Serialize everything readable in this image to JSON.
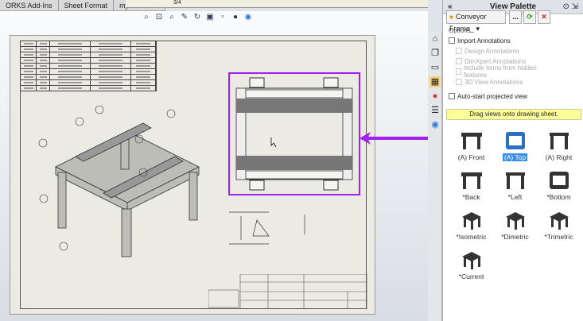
{
  "tabs": [
    "ORKS Add-Ins",
    "Sheet Format",
    "myCADtools"
  ],
  "ruler_label": "3/4",
  "toolbar_icons": [
    "zoom-to-fit-icon",
    "zoom-area-icon",
    "zoom-in-out-icon",
    "pan-icon",
    "rotate-icon",
    "display-style-icon",
    "hide-show-icon",
    "appearance-icon",
    "scene-icon"
  ],
  "panel": {
    "title": "View Palette",
    "collapse": "«",
    "pin": "⊙ ⇲",
    "part": "Conveyor Frame_",
    "browse": "...",
    "options_label": "Options",
    "options": [
      {
        "label": "Import Annotations",
        "enabled": true,
        "checked": false
      },
      {
        "label": "Design Annotations",
        "enabled": false,
        "checked": false
      },
      {
        "label": "DimXpert Annotations",
        "enabled": false,
        "checked": false
      },
      {
        "label": "Include items from hidden features",
        "enabled": false,
        "checked": false
      },
      {
        "label": "3D View Annotations",
        "enabled": false,
        "checked": false
      }
    ],
    "auto_start": "Auto-start projected view",
    "hint": "Drag views onto drawing sheet.",
    "views": [
      {
        "label": "(A) Front",
        "shape": "front"
      },
      {
        "label": "(A) Top",
        "shape": "top",
        "selected": true
      },
      {
        "label": "(A) Right",
        "shape": "side"
      },
      {
        "label": "*Back",
        "shape": "front"
      },
      {
        "label": "*Left",
        "shape": "side"
      },
      {
        "label": "*Bottom",
        "shape": "top"
      },
      {
        "label": "*Isometric",
        "shape": "iso"
      },
      {
        "label": "*Dimetric",
        "shape": "iso"
      },
      {
        "label": "*Trimetric",
        "shape": "iso"
      },
      {
        "label": "*Current",
        "shape": "iso"
      }
    ]
  },
  "colors": {
    "selection": "#a020f0",
    "hint_bg": "#ffff99",
    "selected_view": "#3a8ee6"
  }
}
